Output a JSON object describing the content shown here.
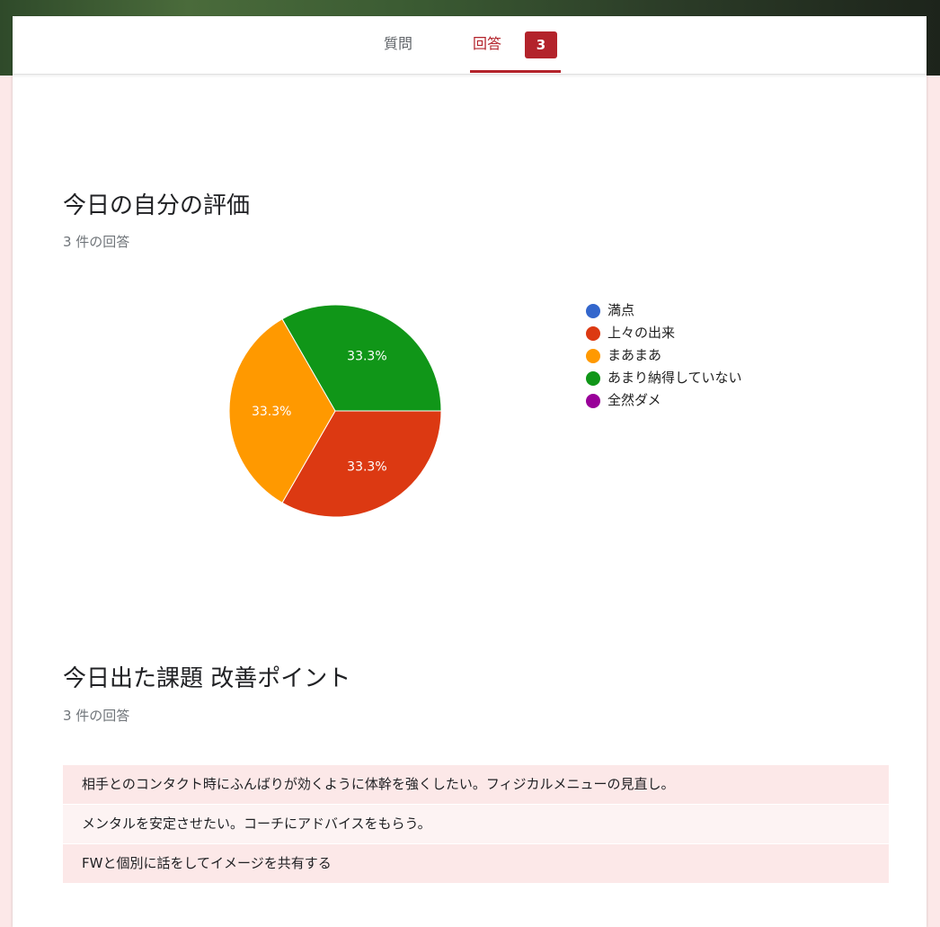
{
  "tabs": {
    "questions_label": "質問",
    "responses_label": "回答",
    "responses_badge": "3"
  },
  "questions": [
    {
      "title": "今日の自分の評価",
      "count_text": "3 件の回答"
    },
    {
      "title": "今日出た課題 改善ポイント",
      "count_text": "3 件の回答",
      "answers": [
        "相手とのコンタクト時にふんばりが効くように体幹を強くしたい。フィジカルメニューの見直し。",
        "メンタルを安定させたい。コーチにアドバイスをもらう。",
        "FWと個別に話をしてイメージを共有する"
      ]
    }
  ],
  "chart_data": {
    "type": "pie",
    "categories": [
      "満点",
      "上々の出来",
      "まあまあ",
      "あまり納得していない",
      "全然ダメ"
    ],
    "values": [
      0,
      1,
      1,
      1,
      0
    ],
    "colors": [
      "#3366cc",
      "#dc3912",
      "#ff9900",
      "#109618",
      "#990099"
    ],
    "slice_labels": [
      "",
      "33.3%",
      "33.3%",
      "33.3%",
      ""
    ],
    "legend_position": "right"
  }
}
